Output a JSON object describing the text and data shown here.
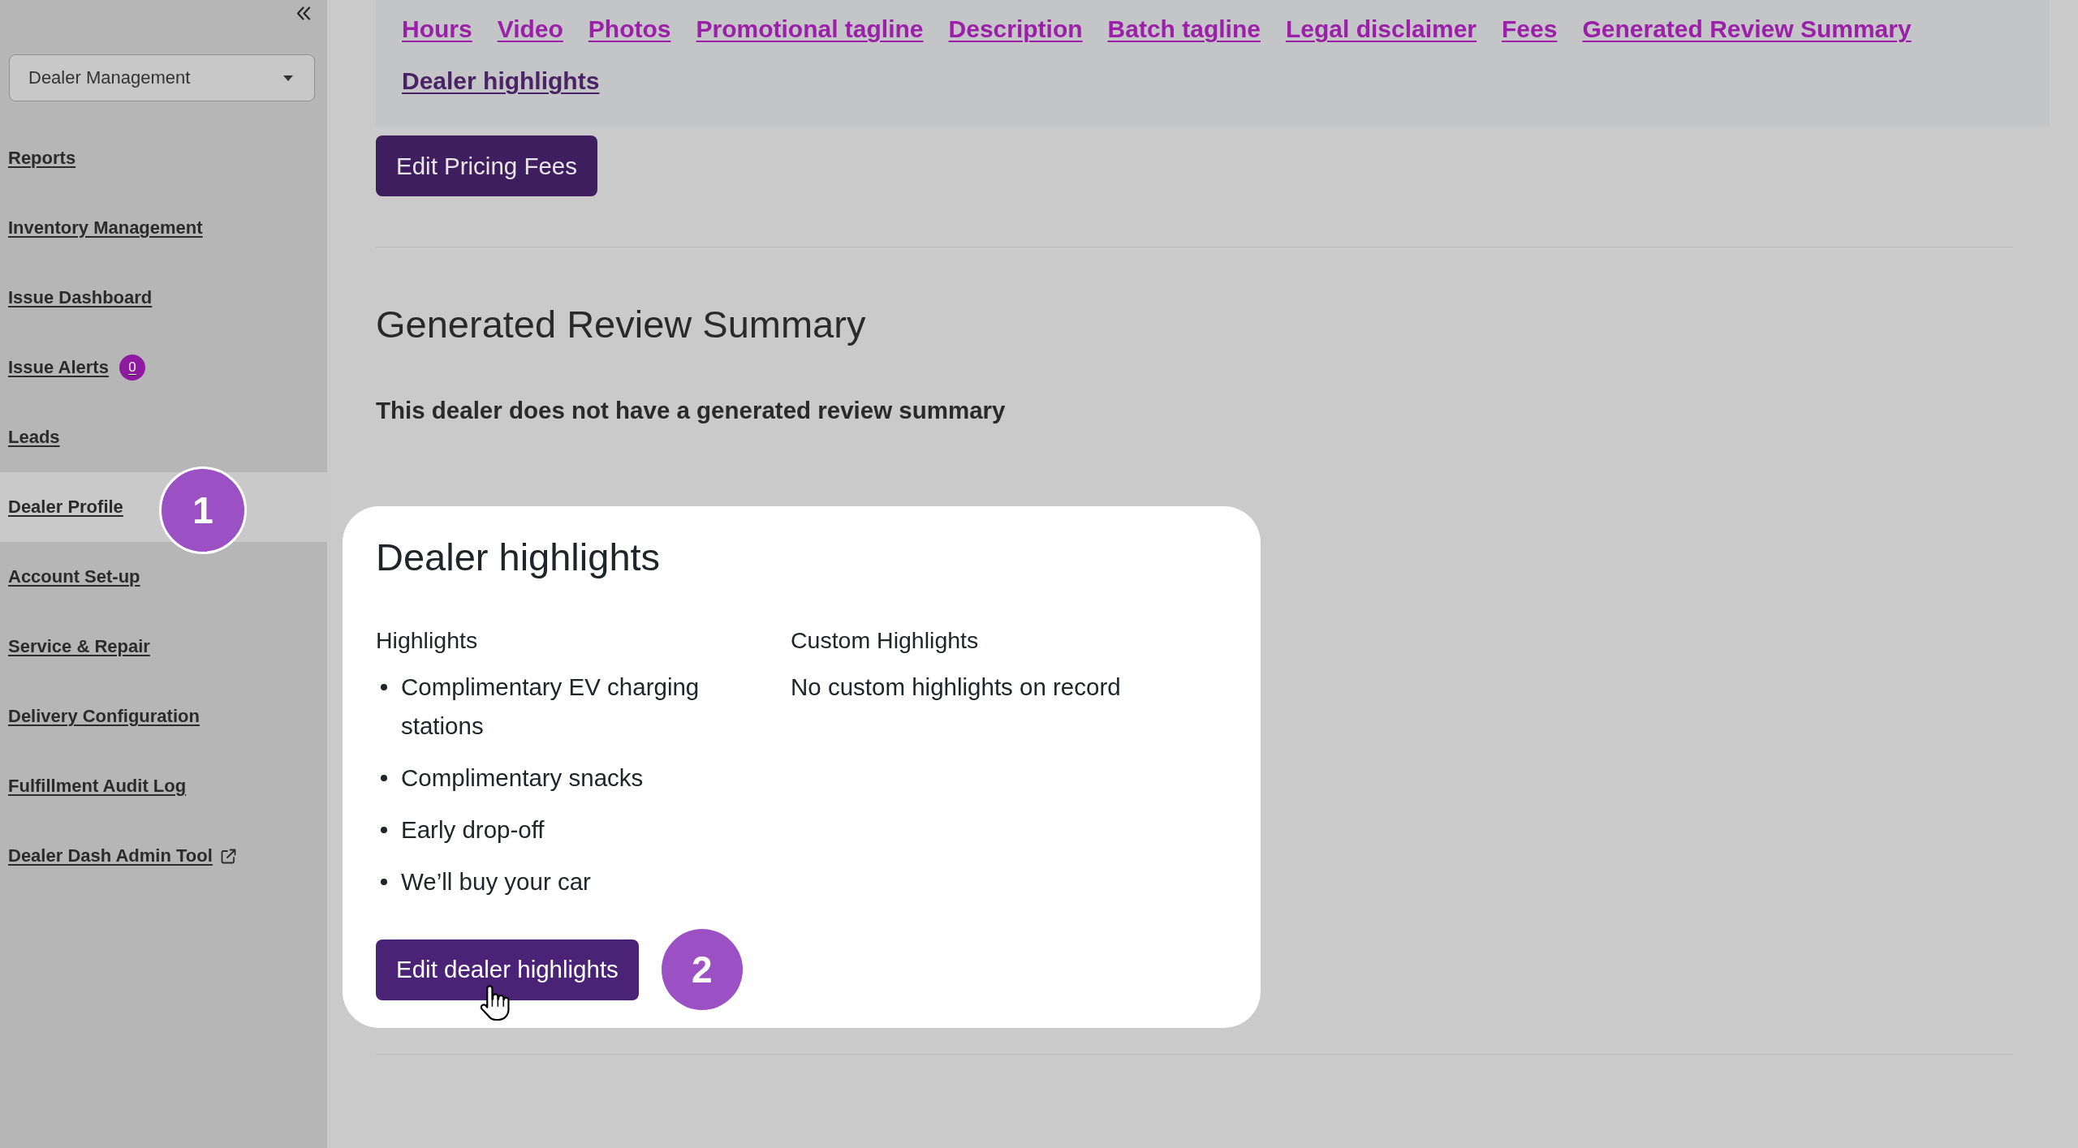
{
  "sidebar": {
    "dropdown": {
      "value": "Dealer Management"
    },
    "nav_items": [
      {
        "label": "Reports",
        "selected": false,
        "external": false
      },
      {
        "label": "Inventory Management",
        "selected": false,
        "external": false
      },
      {
        "label": "Issue Dashboard",
        "selected": false,
        "external": false
      },
      {
        "label": "Issue Alerts",
        "selected": false,
        "external": false,
        "badge": "0"
      },
      {
        "label": "Leads",
        "selected": false,
        "external": false
      },
      {
        "label": "Dealer Profile",
        "selected": true,
        "external": false,
        "step": "1"
      },
      {
        "label": "Account Set-up",
        "selected": false,
        "external": false
      },
      {
        "label": "Service & Repair",
        "selected": false,
        "external": false
      },
      {
        "label": "Delivery Configuration",
        "selected": false,
        "external": false
      },
      {
        "label": "Fulfillment Audit Log",
        "selected": false,
        "external": false
      },
      {
        "label": "Dealer Dash Admin Tool",
        "selected": false,
        "external": true
      }
    ]
  },
  "section_links": [
    {
      "label": "Hours",
      "selected": false
    },
    {
      "label": "Video",
      "selected": false
    },
    {
      "label": "Photos",
      "selected": false
    },
    {
      "label": "Promotional tagline",
      "selected": false
    },
    {
      "label": "Description",
      "selected": false
    },
    {
      "label": "Batch tagline",
      "selected": false
    },
    {
      "label": "Legal disclaimer",
      "selected": false
    },
    {
      "label": "Fees",
      "selected": false
    },
    {
      "label": "Generated Review Summary",
      "selected": false
    },
    {
      "label": "Dealer highlights",
      "selected": true
    }
  ],
  "pricing_button": {
    "label": "Edit Pricing Fees"
  },
  "review_summary": {
    "title": "Generated Review Summary",
    "message": "This dealer does not have a generated review summary"
  },
  "highlights_card": {
    "title": "Dealer highlights",
    "highlights": {
      "heading": "Highlights",
      "items": [
        "Complimentary EV charging stations",
        "Complimentary snacks",
        "Early drop-off",
        "We’ll buy your car"
      ]
    },
    "custom_highlights": {
      "heading": "Custom Highlights",
      "message": "No custom highlights on record"
    },
    "edit_button": {
      "label": "Edit dealer highlights",
      "step": "2"
    }
  }
}
